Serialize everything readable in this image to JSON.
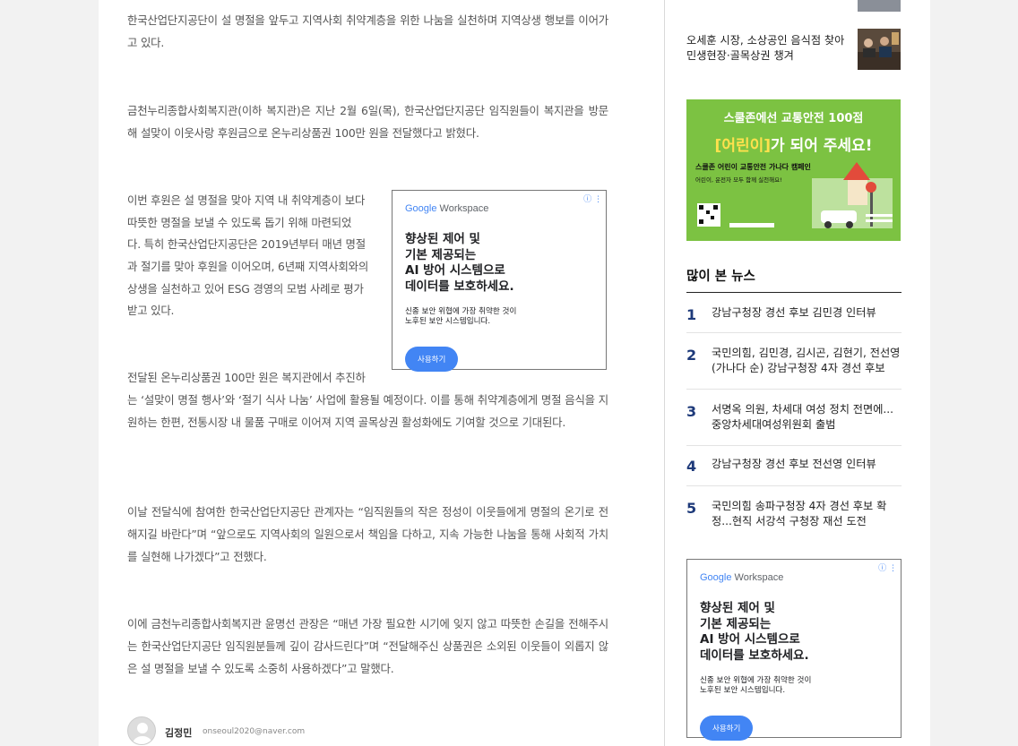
{
  "article": {
    "paragraphs": [
      " 한국산업단지공단이 설 명절을 앞두고 지역사회 취약계층을 위한 나눔을 실천하며 지역상생 행보를 이어가고 있다.",
      "금천누리종합사회복지관(이하 복지관)은 지난 2월 6일(목), 한국산업단지공단 임직원들이 복지관을 방문해 설맞이 이웃사랑 후원금으로 온누리상품권 100만 원을 전달했다고 밝혔다.",
      "이번 후원은 설 명절을 맞아 지역 내 취약계층이 보다",
      "따뜻한 명절을 보낼 수 있도록 돕기 위해 마련되었",
      "다. 특히 한국산업단지공단은 2019년부터 매년 명절",
      "과 절기를 맞아 후원을 이어오며, 6년째 지역사회와의",
      "상생을 실천하고 있어 ESG 경영의 모범 사례로 평가",
      "받고 있다.",
      "전달된 온누리상품권 100만 원은 복지관에서 추진하",
      "는 ‘설맞이 명절 행사’와 ‘절기 식사 나눔’ 사업에 활용될 예정이다. 이를 통해 취약계층에게 명절 음식을 지원하는 한편, 전통시장 내 물품 구매로 이어져 지역 골목상권 활성화에도 기여할 것으로 기대된다.",
      "이날 전달식에 참여한 한국산업단지공단 관계자는 “임직원들의 작은 정성이 이웃들에게 명절의 온기로 전해지길 바란다”며 “앞으로도 지역사회의 일원으로서 책임을 다하고, 지속 가능한 나눔을 통해 사회적 가치를 실현해 나가겠다”고 전했다.",
      "이에 금천누리종합사회복지관 윤명선 관장은 “매년 가장 필요한 시기에 잊지 않고 따뜻한 손길을 전해주시는 한국산업단지공단 임직원분들께 깊이 감사드린다”며 “전달해주신 상품권은 소외된 이웃들이 외롭지 않은 설 명절을 보낼 수 있도록 소중히 사용하겠다”고 말했다."
    ],
    "author_name": "김정민",
    "author_email": "onseoul2020@naver.com"
  },
  "ad": {
    "brand_google": "Google",
    "brand_workspace": " Workspace",
    "headline": "향상된 제어 및\n기본 제공되는\nAI 방어 시스템으로\n데이터를 보호하세요.",
    "subtext": "신종 보안 위협에 가장 취약한 것이\n노후된 보안 시스템입니다.",
    "button": "사용하기",
    "info": "ⓘ ⋮"
  },
  "sidebar": {
    "news": [
      {
        "title": "오세훈 시장, 소상공인 음식점 찾아 민생현장·골목상권 챙겨"
      }
    ],
    "banner": {
      "line1": "스쿨존에선 교통안전 100점",
      "line2_hl": "[어린이]",
      "line2_rest": "가 되어 주세요!",
      "line3": "스쿨존 어린이 교통안전 가나다 캠페인",
      "line4": "어린이, 운전자 모두 함께 실천해요!"
    },
    "popular_title": "많이 본 뉴스",
    "popular": [
      {
        "rank": "1",
        "title": "강남구청장 경선 후보 김민경 인터뷰"
      },
      {
        "rank": "2",
        "title": "국민의힘, 김민경, 김시곤, 김현기, 전선영(가나다 순) 강남구청장 4자 경선 후보"
      },
      {
        "rank": "3",
        "title": "서명옥 의원, 차세대 여성 정치 전면에... 중앙차세대여성위원회 출범"
      },
      {
        "rank": "4",
        "title": "강남구청장 경선 후보 전선영 인터뷰"
      },
      {
        "rank": "5",
        "title": "국민의힘 송파구청장 4자 경선 후보 확정...현직 서강석 구청장 재선 도전"
      }
    ]
  }
}
